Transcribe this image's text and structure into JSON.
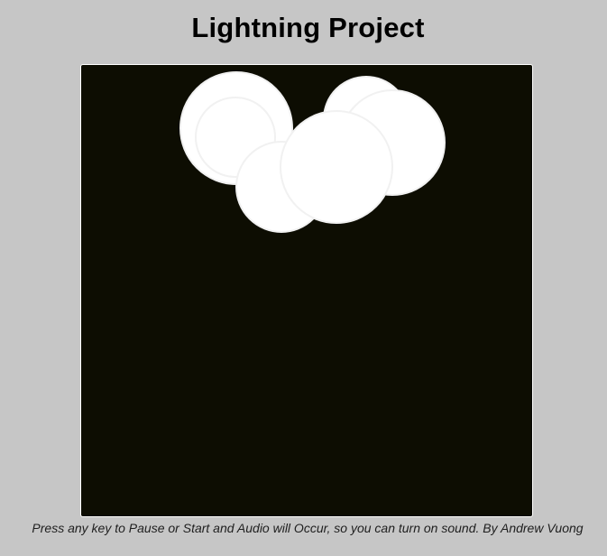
{
  "page": {
    "title": "Lightning Project",
    "footer": "Press any key to Pause or Start and Audio will Occur, so you can turn on sound. By Andrew Vuong"
  },
  "canvas": {
    "background_color": "#0d0d02",
    "cloud_color": "#ffffff",
    "cloud_outline_color": "#f1f1f1",
    "paused": true,
    "lightning_visible": false
  }
}
